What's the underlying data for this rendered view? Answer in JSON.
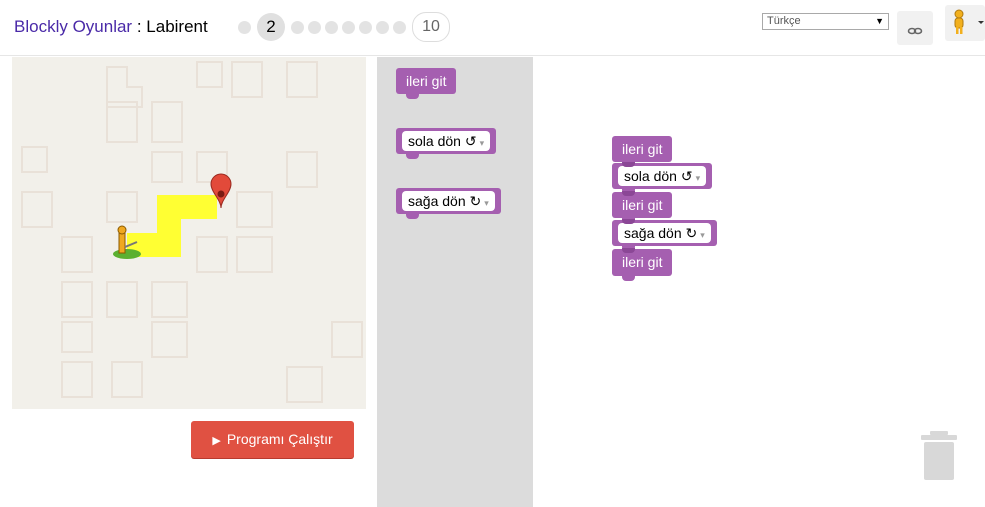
{
  "header": {
    "app_title": "Blockly Oyunlar",
    "separator": " : ",
    "game_title": "Labirent",
    "current_level": "2",
    "last_level": "10",
    "language": "Türkçe",
    "link_icon": "link-icon",
    "pegman_icon": "pegman-icon"
  },
  "maze": {
    "start_icon": "pegman-icon",
    "finish_icon": "map-marker-icon",
    "path_color": "#ffff33"
  },
  "run_button": {
    "icon": "play-icon",
    "label": "Programı Çalıştır"
  },
  "toolbox": {
    "blocks": [
      {
        "label": "ileri git"
      },
      {
        "label": "sola dön ↺"
      },
      {
        "label": "sağa dön ↻"
      }
    ]
  },
  "workspace": {
    "blocks": [
      {
        "label": "ileri git"
      },
      {
        "label": "sola dön ↺"
      },
      {
        "label": "ileri git"
      },
      {
        "label": "sağa dön ↻"
      },
      {
        "label": "ileri git"
      }
    ]
  },
  "colors": {
    "block": "#a55fb0",
    "run_button": "#e05142",
    "toolbox": "#dcdcdc",
    "maze_bg": "#f2f0ea"
  },
  "trash_icon": "trash-can-icon"
}
